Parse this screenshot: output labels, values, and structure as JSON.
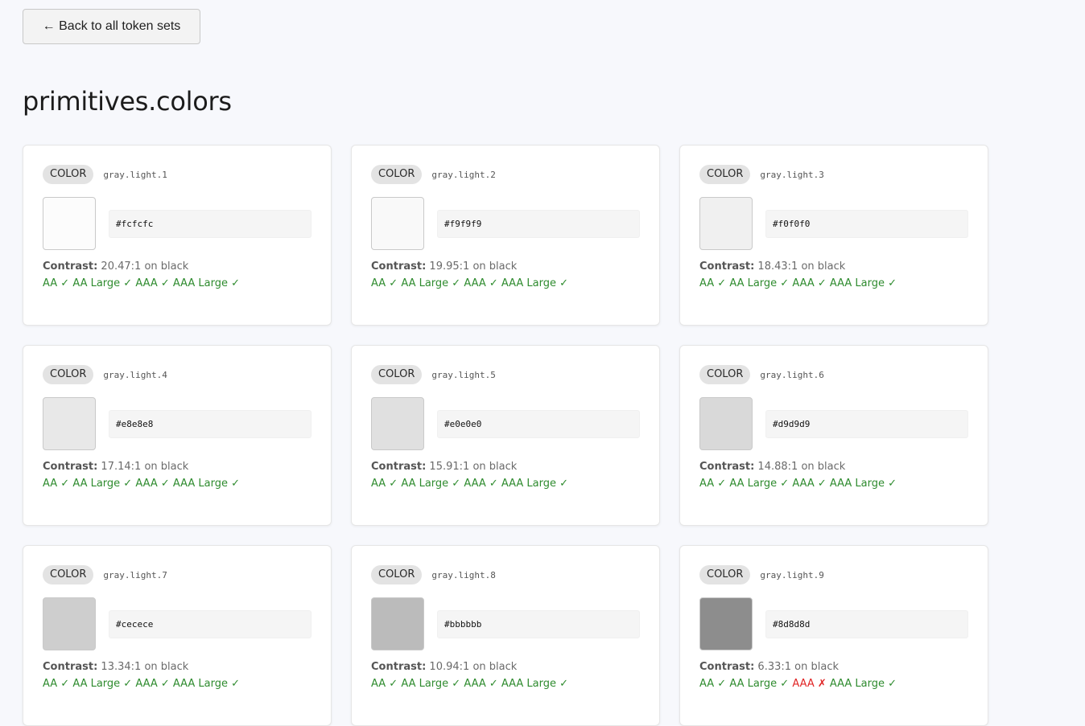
{
  "back_button": {
    "label": "← Back to all token sets"
  },
  "page_title": "primitives.colors",
  "contrast_label": "Contrast:",
  "contrast_suffix": "on black",
  "tokens": [
    {
      "type": "COLOR",
      "name": "gray.light.1",
      "value": "#fcfcfc",
      "ratio": "20.47:1",
      "checks": [
        {
          "label": "AA",
          "pass": true
        },
        {
          "label": "AA Large",
          "pass": true
        },
        {
          "label": "AAA",
          "pass": true
        },
        {
          "label": "AAA Large",
          "pass": true
        }
      ]
    },
    {
      "type": "COLOR",
      "name": "gray.light.2",
      "value": "#f9f9f9",
      "ratio": "19.95:1",
      "checks": [
        {
          "label": "AA",
          "pass": true
        },
        {
          "label": "AA Large",
          "pass": true
        },
        {
          "label": "AAA",
          "pass": true
        },
        {
          "label": "AAA Large",
          "pass": true
        }
      ]
    },
    {
      "type": "COLOR",
      "name": "gray.light.3",
      "value": "#f0f0f0",
      "ratio": "18.43:1",
      "checks": [
        {
          "label": "AA",
          "pass": true
        },
        {
          "label": "AA Large",
          "pass": true
        },
        {
          "label": "AAA",
          "pass": true
        },
        {
          "label": "AAA Large",
          "pass": true
        }
      ]
    },
    {
      "type": "COLOR",
      "name": "gray.light.4",
      "value": "#e8e8e8",
      "ratio": "17.14:1",
      "checks": [
        {
          "label": "AA",
          "pass": true
        },
        {
          "label": "AA Large",
          "pass": true
        },
        {
          "label": "AAA",
          "pass": true
        },
        {
          "label": "AAA Large",
          "pass": true
        }
      ]
    },
    {
      "type": "COLOR",
      "name": "gray.light.5",
      "value": "#e0e0e0",
      "ratio": "15.91:1",
      "checks": [
        {
          "label": "AA",
          "pass": true
        },
        {
          "label": "AA Large",
          "pass": true
        },
        {
          "label": "AAA",
          "pass": true
        },
        {
          "label": "AAA Large",
          "pass": true
        }
      ]
    },
    {
      "type": "COLOR",
      "name": "gray.light.6",
      "value": "#d9d9d9",
      "ratio": "14.88:1",
      "checks": [
        {
          "label": "AA",
          "pass": true
        },
        {
          "label": "AA Large",
          "pass": true
        },
        {
          "label": "AAA",
          "pass": true
        },
        {
          "label": "AAA Large",
          "pass": true
        }
      ]
    },
    {
      "type": "COLOR",
      "name": "gray.light.7",
      "value": "#cecece",
      "ratio": "13.34:1",
      "checks": [
        {
          "label": "AA",
          "pass": true
        },
        {
          "label": "AA Large",
          "pass": true
        },
        {
          "label": "AAA",
          "pass": true
        },
        {
          "label": "AAA Large",
          "pass": true
        }
      ]
    },
    {
      "type": "COLOR",
      "name": "gray.light.8",
      "value": "#bbbbbb",
      "ratio": "10.94:1",
      "checks": [
        {
          "label": "AA",
          "pass": true
        },
        {
          "label": "AA Large",
          "pass": true
        },
        {
          "label": "AAA",
          "pass": true
        },
        {
          "label": "AAA Large",
          "pass": true
        }
      ]
    },
    {
      "type": "COLOR",
      "name": "gray.light.9",
      "value": "#8d8d8d",
      "ratio": "6.33:1",
      "checks": [
        {
          "label": "AA",
          "pass": true
        },
        {
          "label": "AA Large",
          "pass": true
        },
        {
          "label": "AAA",
          "pass": false
        },
        {
          "label": "AAA Large",
          "pass": true
        }
      ]
    }
  ],
  "glyphs": {
    "pass": "✓",
    "fail": "✗"
  },
  "colors": {
    "pass": "#2e8b2e",
    "fail": "#e02424",
    "background": "#f7f8fc"
  }
}
